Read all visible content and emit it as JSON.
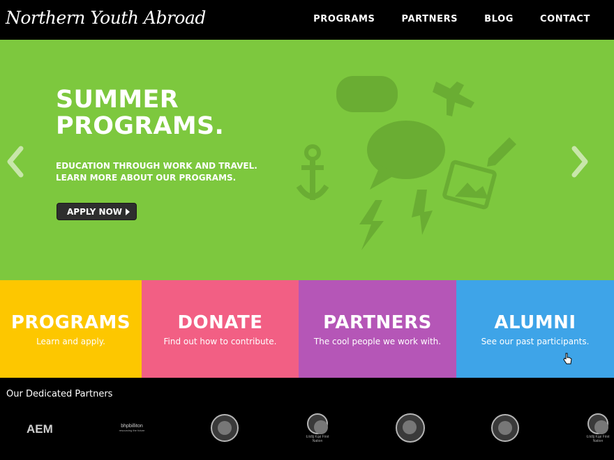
{
  "nav": {
    "logo": "Northern Youth Abroad",
    "items": [
      {
        "label": "PROGRAMS"
      },
      {
        "label": "PARTNERS"
      },
      {
        "label": "BLOG"
      },
      {
        "label": "CONTACT"
      }
    ]
  },
  "hero": {
    "title_line1": "SUMMER",
    "title_line2": "PROGRAMS.",
    "subtitle_line1": "EDUCATION THROUGH WORK AND TRAVEL.",
    "subtitle_line2": "LEARN MORE ABOUT OUR PROGRAMS.",
    "cta_label": "APPLY NOW",
    "background_color": "#7dc83e",
    "icons": [
      "gamepad-icon",
      "airplane-icon",
      "speech-bubble-icon",
      "anchor-icon",
      "pencil-icon",
      "picture-icon",
      "lightning-icon"
    ]
  },
  "tiles": [
    {
      "title": "PROGRAMS",
      "subtitle": "Learn and apply.",
      "color": "#fdc700"
    },
    {
      "title": "DONATE",
      "subtitle": "Find out how to contribute.",
      "color": "#f25f84"
    },
    {
      "title": "PARTNERS",
      "subtitle": "The cool people we work with.",
      "color": "#b556b7"
    },
    {
      "title": "ALUMNI",
      "subtitle": "See our past participants.",
      "color": "#3ea4e8"
    }
  ],
  "partners": {
    "title": "Our Dedicated Partners",
    "logos": [
      {
        "text": "AEM"
      },
      {
        "text": "bhpbilliton",
        "tagline": "resourcing the future"
      },
      {
        "text": ""
      },
      {
        "text": "Łiídlįį Kų́ę́ First Nation"
      },
      {
        "text": ""
      },
      {
        "text": ""
      },
      {
        "text": "Łiídlįį Kų́ę́ First Nation"
      }
    ]
  }
}
